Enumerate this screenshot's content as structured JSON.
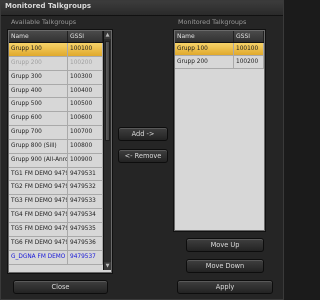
{
  "window": {
    "title": "Monitored Talkgroups"
  },
  "available": {
    "label": "Available Talkgroups",
    "columns": [
      "Name",
      "GSSI"
    ],
    "rows": [
      {
        "name": "Grupp 100",
        "gssi": "100100",
        "state": "selected"
      },
      {
        "name": "Grupp 200",
        "gssi": "100200",
        "state": "dim"
      },
      {
        "name": "Grupp 300",
        "gssi": "100300",
        "state": ""
      },
      {
        "name": "Grupp 400",
        "gssi": "100400",
        "state": ""
      },
      {
        "name": "Grupp 500",
        "gssi": "100500",
        "state": ""
      },
      {
        "name": "Grupp 600",
        "gssi": "100600",
        "state": ""
      },
      {
        "name": "Grupp 700",
        "gssi": "100700",
        "state": ""
      },
      {
        "name": "Grupp 800 (Sill)",
        "gssi": "100800",
        "state": ""
      },
      {
        "name": "Grupp 900 (All-Anrop",
        "gssi": "100900",
        "state": ""
      },
      {
        "name": "TG1 FM DEMO 9479",
        "gssi": "9479531",
        "state": ""
      },
      {
        "name": "TG2 FM DEMO 9479",
        "gssi": "9479532",
        "state": ""
      },
      {
        "name": "TG3 FM DEMO 9479",
        "gssi": "9479533",
        "state": ""
      },
      {
        "name": "TG4 FM DEMO 9479",
        "gssi": "9479534",
        "state": ""
      },
      {
        "name": "TG5 FM DEMO 9479",
        "gssi": "9479535",
        "state": ""
      },
      {
        "name": "TG6 FM DEMO 9479",
        "gssi": "9479536",
        "state": ""
      },
      {
        "name": "G_DGNA FM DEMO 9",
        "gssi": "9479537",
        "state": "blue"
      }
    ]
  },
  "monitored": {
    "label": "Monitored Talkgroups",
    "columns": [
      "Name",
      "GSSI"
    ],
    "rows": [
      {
        "name": "Grupp 100",
        "gssi": "100100",
        "state": "selected"
      },
      {
        "name": "Grupp 200",
        "gssi": "100200",
        "state": ""
      }
    ]
  },
  "buttons": {
    "add": "Add ->",
    "remove": "<- Remove",
    "move_up": "Move Up",
    "move_down": "Move Down",
    "close": "Close",
    "apply": "Apply"
  },
  "icons": {
    "scroll_up": "up-arrow-icon",
    "scroll_down": "down-arrow-icon"
  }
}
